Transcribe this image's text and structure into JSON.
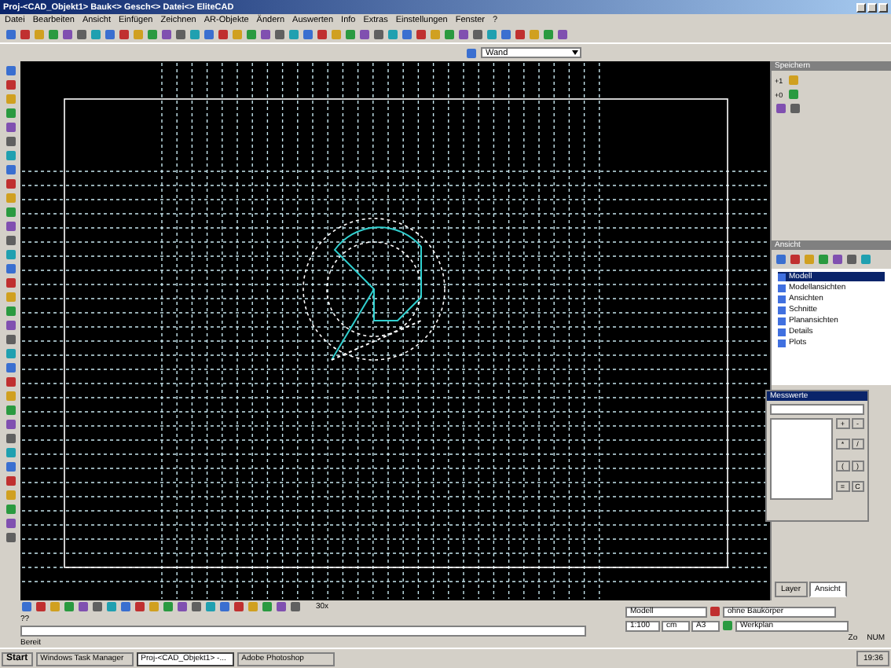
{
  "window": {
    "title": "Proj-<CAD_Objekt1> Bauk<> Gesch<> Datei<> EliteCAD"
  },
  "menu": [
    "Datei",
    "Bearbeiten",
    "Ansicht",
    "Einfügen",
    "Zeichnen",
    "AR-Objekte",
    "Ändern",
    "Auswerten",
    "Info",
    "Extras",
    "Einstellungen",
    "Fenster",
    "?"
  ],
  "object_type": {
    "value": "Wand"
  },
  "panels": {
    "top": {
      "title": "Speichern",
      "labels": [
        "+1",
        "+0"
      ]
    },
    "view": {
      "title": "Ansicht",
      "tree": [
        {
          "label": "Modell",
          "selected": true
        },
        {
          "label": "Modellansichten",
          "selected": false
        },
        {
          "label": "Ansichten",
          "selected": false
        },
        {
          "label": "Schnitte",
          "selected": false
        },
        {
          "label": "Planansichten",
          "selected": false
        },
        {
          "label": "Details",
          "selected": false
        },
        {
          "label": "Plots",
          "selected": false
        }
      ]
    },
    "measure": {
      "title": "Messwerte",
      "keys": [
        "+",
        "-",
        "*",
        "/",
        "(",
        ")",
        "=",
        "C"
      ]
    },
    "tabs": [
      {
        "label": "Layer",
        "selected": false
      },
      {
        "label": "Ansicht",
        "selected": true
      }
    ]
  },
  "command": {
    "prompt": "??",
    "status": "Bereit",
    "count": "30x"
  },
  "view_settings": {
    "model": "Modell",
    "scale": "1:100",
    "unit": "cm",
    "paper": "A3",
    "body": "ohne Baukörper",
    "plan": "Werkplan"
  },
  "status_bar": {
    "zoom": "Zo",
    "num": "NUM"
  },
  "taskbar": {
    "start": "Start",
    "items": [
      {
        "label": "Windows Task Manager",
        "selected": false
      },
      {
        "label": "Proj-<CAD_Objekt1> -...",
        "selected": true
      },
      {
        "label": "Adobe Photoshop",
        "selected": false
      }
    ],
    "clock": "19:36"
  }
}
